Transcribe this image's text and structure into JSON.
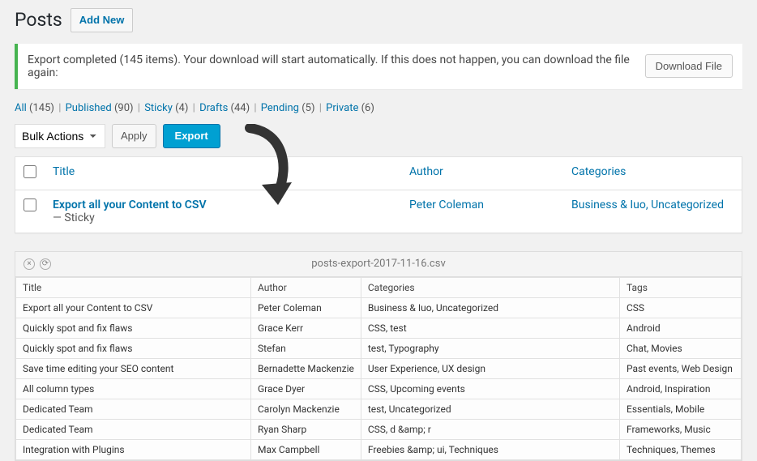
{
  "header": {
    "title": "Posts",
    "add_new": "Add New"
  },
  "notice": {
    "text": "Export completed (145 items). Your download will start automatically. If this does not happen, you can download the file again:",
    "button": "Download File"
  },
  "filters": [
    {
      "label": "All",
      "count": "(145)"
    },
    {
      "label": "Published",
      "count": "(90)"
    },
    {
      "label": "Sticky",
      "count": "(4)"
    },
    {
      "label": "Drafts",
      "count": "(44)"
    },
    {
      "label": "Pending",
      "count": "(5)"
    },
    {
      "label": "Private",
      "count": "(6)"
    }
  ],
  "actions": {
    "bulk": "Bulk Actions",
    "apply": "Apply",
    "export": "Export"
  },
  "columns": {
    "title": "Title",
    "author": "Author",
    "categories": "Categories"
  },
  "row": {
    "title": "Export all your Content to CSV",
    "sticky": "— Sticky",
    "author": "Peter Coleman",
    "categories": "Business & Iuo, Uncategorized"
  },
  "csv": {
    "filename": "posts-export-2017-11-16.csv",
    "headers": {
      "title": "Title",
      "author": "Author",
      "categories": "Categories",
      "tags": "Tags"
    },
    "rows": [
      {
        "title": "Export all your Content to CSV",
        "author": "Peter Coleman",
        "categories": "Business & Iuo, Uncategorized",
        "tags": "CSS"
      },
      {
        "title": "Quickly spot and fix flaws",
        "author": "Grace Kerr",
        "categories": "CSS, test",
        "tags": "Android"
      },
      {
        "title": "Quickly spot and fix flaws",
        "author": "Stefan",
        "categories": "test, Typography",
        "tags": "Chat, Movies"
      },
      {
        "title": "Save time editing your SEO content",
        "author": "Bernadette Mackenzie",
        "categories": "User Experience, UX design",
        "tags": "Past events, Web Design"
      },
      {
        "title": "All column types",
        "author": "Grace Dyer",
        "categories": "CSS, Upcoming events",
        "tags": "Android, Inspiration"
      },
      {
        "title": "Dedicated Team",
        "author": "Carolyn Mackenzie",
        "categories": "test, Uncategorized",
        "tags": "Essentials, Mobile"
      },
      {
        "title": "Dedicated Team",
        "author": "Ryan Sharp",
        "categories": "CSS, d &amp; r",
        "tags": "Frameworks, Music"
      },
      {
        "title": "Integration with Plugins",
        "author": "Max Campbell",
        "categories": "Freebies &amp; ui, Techniques",
        "tags": "Techniques, Themes"
      }
    ]
  }
}
